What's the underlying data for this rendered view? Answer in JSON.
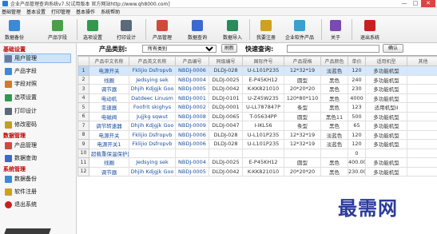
{
  "window": {
    "title": "企业产品管理查询系统v7.5[试用版本 官方网站http://www.qh8000.com]",
    "controls": {
      "minimize": "—",
      "maximize": "□",
      "close": "✕"
    }
  },
  "menubar": [
    "基础管理",
    "基本设置",
    "打印管理",
    "基本操作",
    "系统帮助"
  ],
  "toolbar": [
    {
      "label": "数据备份",
      "icon": "database-backup-icon",
      "color": "#3a8ad8"
    },
    {
      "label": "产品字段",
      "icon": "product-field-icon",
      "color": "#4aa04a"
    },
    {
      "label": "选项设置",
      "icon": "options-icon",
      "color": "#2f9a4d"
    },
    {
      "label": "打印设计",
      "icon": "printer-icon",
      "color": "#5a6a7a"
    },
    {
      "label": "产品管理",
      "icon": "product-manage-icon",
      "color": "#d04a3a"
    },
    {
      "label": "数据查询",
      "icon": "data-query-icon",
      "color": "#3a6ad0"
    },
    {
      "label": "数据导入",
      "icon": "data-import-icon",
      "color": "#2a8a5a"
    },
    {
      "label": "我要注册",
      "icon": "register-icon",
      "color": "#d0a020"
    },
    {
      "label": "企业软件产品",
      "icon": "software-product-icon",
      "color": "#3aa0d0"
    },
    {
      "label": "关于",
      "icon": "about-icon",
      "color": "#7a4ab0"
    },
    {
      "label": "退出系统",
      "icon": "exit-icon",
      "color": "#c82020"
    }
  ],
  "sidebar": {
    "groups": [
      {
        "title": "基础设置",
        "items": [
          {
            "label": "用户管理",
            "icon": "users-icon",
            "color": "#6a7a9a"
          },
          {
            "label": "产品字段",
            "icon": "product-field-icon",
            "color": "#3a8ad8"
          },
          {
            "label": "字段对照",
            "icon": "field-map-icon",
            "color": "#d07a2a"
          },
          {
            "label": "选项设置",
            "icon": "options-icon",
            "color": "#2f9a4d"
          },
          {
            "label": "打印设计",
            "icon": "printer-icon",
            "color": "#5a6a7a"
          },
          {
            "label": "修改密码",
            "icon": "key-icon",
            "color": "#c0a020"
          }
        ]
      },
      {
        "title": "数据管理",
        "items": [
          {
            "label": "产品管理",
            "icon": "product-manage-icon",
            "color": "#d04a3a"
          },
          {
            "label": "数据查询",
            "icon": "data-query-icon",
            "color": "#3a6ad0"
          }
        ]
      },
      {
        "title": "系统管理",
        "items": [
          {
            "label": "数据备份",
            "icon": "database-backup-icon",
            "color": "#3a8ad8"
          },
          {
            "label": "软件注册",
            "icon": "register-icon",
            "color": "#d0a020"
          },
          {
            "label": "退出系统",
            "icon": "exit-icon",
            "color": "#c82020"
          }
        ]
      }
    ]
  },
  "filter": {
    "category_label": "产品类别:",
    "category_value": "所有类别",
    "refresh_label": "刷新",
    "quick_search_label": "快速查询:",
    "quick_search_value": "",
    "confirm_label": "确认"
  },
  "table": {
    "columns": [
      "",
      "产品中文名称",
      "产品英文名称",
      "产品编号",
      "同级编号",
      "国际件号",
      "产品规格",
      "产品颜色",
      "单价",
      "适用机型",
      "其他"
    ],
    "rows": [
      [
        "1",
        "电源开关",
        "Fklijio Dsfropvb",
        "NBDJ-0006",
        "DLDJ-028",
        "U-L101P235",
        "12*32*19",
        "淡蓝色",
        "120",
        "多功能机型",
        ""
      ],
      [
        "2",
        "线圈",
        "Jedsying sek",
        "NBDJ-0004",
        "DLDJ-0025",
        "E-P45KH12",
        "圆型",
        "黑色",
        "240",
        "多功能机型",
        ""
      ],
      [
        "3",
        "调节器",
        "Dhjih Kdjgjk Goo",
        "NBDJ-0005",
        "DLDJ-0042",
        "K-KK821010",
        "20*20*20",
        "黑色",
        "230",
        "多功能机型",
        ""
      ],
      [
        "4",
        "电动机",
        "Datdeec Linusm",
        "NBDJ-0001",
        "DLDJ-0101",
        "U-Z45W235",
        "120*80*110",
        "黑色",
        "4000",
        "多功能机型",
        ""
      ],
      [
        "5",
        "变速器",
        "Foofrit skighys",
        "NBDJ-0002",
        "DLDJ-0001",
        "U-LL787847P",
        "条型",
        "黑色",
        "123",
        "适用机型II",
        ""
      ],
      [
        "6",
        "电磁阀",
        "Jujjkg sqwut",
        "NBDJ-0008",
        "DLDJ-0065",
        "T-05634PP",
        "圆型",
        "黑色11",
        "500",
        "多功能机型",
        ""
      ],
      [
        "7",
        "调节转速器",
        "Dhjih Kdjgjk Goo",
        "NBDJ-0009",
        "DLDJ-0047",
        "I-IKL56",
        "条型",
        "黑色",
        "65",
        "多功能机型",
        ""
      ],
      [
        "8",
        "电源开关",
        "Fklijio Dsfropvb",
        "NBDJ-0006",
        "DLDJ-028",
        "U-L101P235",
        "12*32*19",
        "淡蓝色",
        "120",
        "多功能机型",
        ""
      ],
      [
        "9",
        "电源开关1",
        "Fklijio Dsfropvb",
        "NBDJ-0006",
        "DLDJ-028",
        "U-L101P235",
        "12*32*19",
        "淡蓝色",
        "120",
        "多功能机型",
        ""
      ],
      [
        "10",
        "超载重保温保护器",
        "",
        "",
        "",
        "",
        "",
        "",
        "0",
        "",
        ""
      ],
      [
        "11",
        "线圈",
        "Jedsying sek",
        "NBDJ-0004",
        "DLDJ-0025",
        "E-P45KH12",
        "圆型",
        "黑色",
        "400.00",
        "多功能机型",
        ""
      ],
      [
        "12",
        "调节器",
        "Dhjih Kdjgjk Goo",
        "NBDJ-0005",
        "DLDJ-0042",
        "K-KK821010",
        "20*20*20",
        "黑色",
        "230.00",
        "多功能机型",
        ""
      ]
    ]
  },
  "watermark": "最需网"
}
